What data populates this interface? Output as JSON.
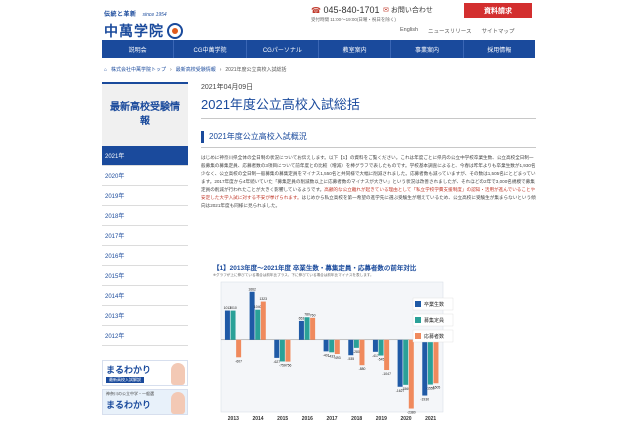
{
  "header": {
    "tagline": "伝統と革新",
    "since": "since 1954",
    "logo_name": "中萬学院",
    "phone": "045-840-1701",
    "hours": "受付時間 11:00〜19:00(日曜・祝日を除く)",
    "inquiry": "お問い合わせ",
    "request_button": "資料請求",
    "sublinks": [
      "English",
      "ニュースリリース",
      "サイトマップ"
    ]
  },
  "nav": [
    "説明会",
    "CG中萬学院",
    "CGパーソナル",
    "教室案内",
    "事業案内",
    "採用情報"
  ],
  "breadcrumb": [
    "株式会社中萬学院トップ",
    "最新高校受験情報",
    "2021年度公立高校入試総括"
  ],
  "sidebar": {
    "heading": "最新高校受験情報",
    "years": [
      "2021年",
      "2020年",
      "2019年",
      "2018年",
      "2017年",
      "2016年",
      "2015年",
      "2014年",
      "2013年",
      "2012年"
    ],
    "banner1_title": "まるわかり",
    "banner1_sub": "最新高校入試解説",
    "banner2_top": "神奈川の公立中学・一般選",
    "banner2_title": "まるわかり"
  },
  "article": {
    "date": "2021年04月09日",
    "title": "2021年度公立高校入試総括",
    "section": "2021年度公立高校入試概況",
    "para1": "はじめに神奈川県全体の全日制の状況についてお伝えします。以下【1】の資料をご覧ください。これは年度ごとに県内の公立中学校卒業生数、公立高校全日制一般募集の募集定員、応募者数の3項目について前年度との比較（増減）を棒グラフで表したものです。学校基本調査によると、今春は昨年よりも卒業生数が1,930名少なく、公立高校の全日制一般募集の募集定員をマイナス1,550名と共同様で大幅に削減されました。応募者数も減っていますが、その数は1,505名にとどまっています。2017年度から4年続いていた「募集定員の削減数以上に応募者数のマイナスが大きい」という状況は改善されましたが、それほどの2年で3,000名規模で募集定員の削減が行われたことが大きく影響しているようです。",
    "para1_red": "高顧的な公立離れが起きている理由として「私立学校学費支援制度」の認知・活用が進んでいることや安定した大学入試に対する不安が挙げられます。",
    "para1_tail": "はじめから私立高校を第一希望の進学先に選ぶ受験生が増えているため、公立高校に受験生が集まらないという傾向は2021年度も同様に見られました。"
  },
  "chart_title": "【1】2013年度〜2021年度  卒業生数・募集定員・応募者数の前年対比",
  "chart_subtitle": "※グラフが上に伸びている場合は前年比プラス、下に伸びている場合は前年比マイナスを表します。",
  "chart_data": {
    "type": "bar",
    "categories": [
      "2013",
      "2014",
      "2015",
      "2016",
      "2017",
      "2018",
      "2019",
      "2020",
      "2021"
    ],
    "series": [
      {
        "name": "卒業生数",
        "color": "#1f5aa6",
        "values": [
          1012,
          1662,
          -627,
          653,
          -401,
          -535,
          -417,
          -1627,
          -1930
        ]
      },
      {
        "name": "募集定員",
        "color": "#2aa198",
        "values": [
          1010,
          1040,
          -750,
          780,
          -433,
          -280,
          -545,
          -1560,
          -1550
        ]
      },
      {
        "name": "応募者数",
        "color": "#f08a5d",
        "values": [
          -607,
          1323,
          -756,
          760,
          -493,
          -880,
          -1047,
          -2380,
          -1505
        ]
      }
    ],
    "ylim": [
      -2500,
      2000
    ]
  }
}
